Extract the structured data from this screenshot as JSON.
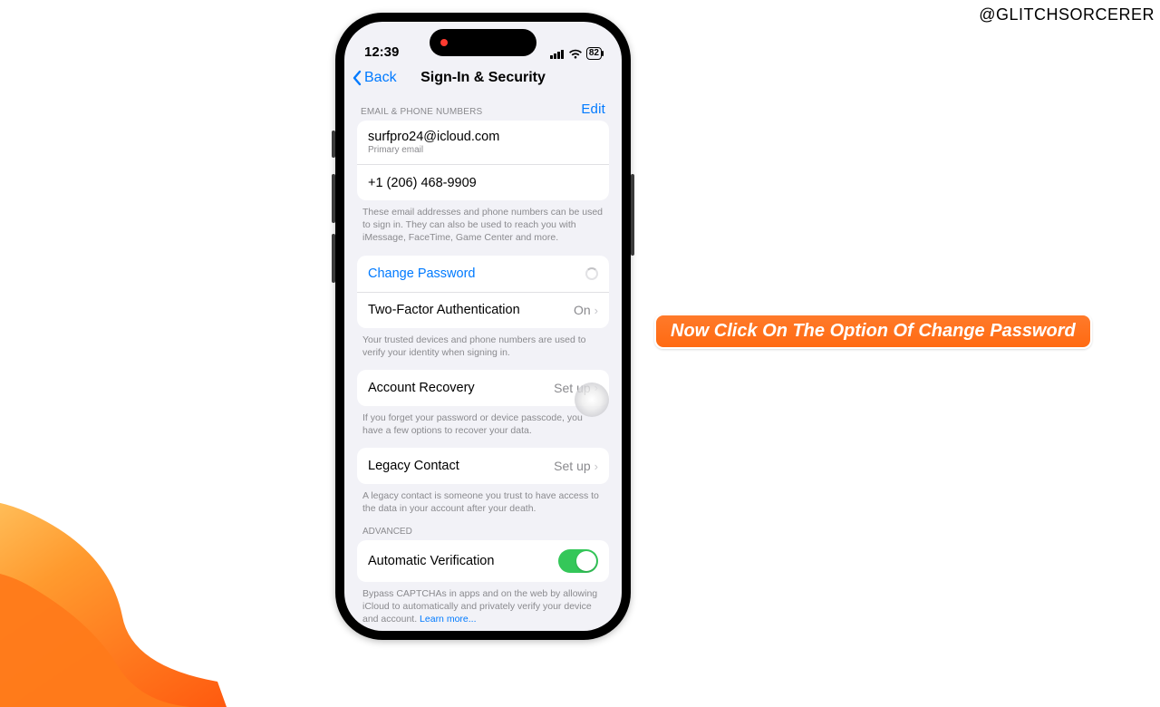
{
  "watermark": "@GLITCHSORCERER",
  "callout_text": "Now Click On The Option Of Change Password",
  "status": {
    "time": "12:39",
    "battery": "82"
  },
  "nav": {
    "back": "Back",
    "title": "Sign-In & Security"
  },
  "section1": {
    "header": "EMAIL & PHONE NUMBERS",
    "edit": "Edit",
    "email": "surfpro24@icloud.com",
    "email_sub": "Primary email",
    "phone": "+1 (206) 468-9909",
    "footer": "These email addresses and phone numbers can be used to sign in. They can also be used to reach you with iMessage, FaceTime, Game Center and more."
  },
  "section2": {
    "change_password": "Change Password",
    "twofa_label": "Two-Factor Authentication",
    "twofa_value": "On",
    "footer": "Your trusted devices and phone numbers are used to verify your identity when signing in."
  },
  "section3": {
    "label": "Account Recovery",
    "value": "Set up",
    "footer": "If you forget your password or device passcode, you have a few options to recover your data."
  },
  "section4": {
    "label": "Legacy Contact",
    "value": "Set up",
    "footer": "A legacy contact is someone you trust to have access to the data in your account after your death."
  },
  "section5": {
    "header": "ADVANCED",
    "label": "Automatic Verification",
    "toggle": true,
    "footer": "Bypass CAPTCHAs in apps and on the web by allowing iCloud to automatically and privately verify your device and account. ",
    "learn_more": "Learn more..."
  }
}
